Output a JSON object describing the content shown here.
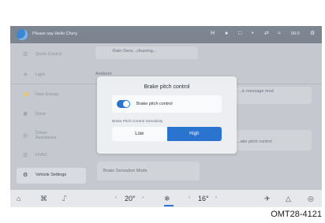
{
  "statusbar": {
    "prompt": "Please say Hello Chery",
    "icons": [
      "H",
      "●",
      "□",
      "•",
      "⇄",
      "≈"
    ],
    "time": "00:0",
    "settings_icon": "⚙"
  },
  "sidebar": {
    "items": [
      {
        "icon": "☰",
        "label": "Quick Control"
      },
      {
        "icon": "☀",
        "label": "Light"
      },
      {
        "icon": "⚡",
        "label": "New Energy"
      },
      {
        "icon": "☸",
        "label": "Drive"
      },
      {
        "icon": "◎",
        "label": "Driver Assistance"
      },
      {
        "icon": "☰",
        "label": "HVAC"
      },
      {
        "icon": "⚙",
        "label": "Vehicle Settings"
      }
    ]
  },
  "background": {
    "top_text": "Rain-Sens...cleaning...",
    "left_text": "Ambient",
    "right_text": "...ic message mod",
    "right_text2": "...ake pitch control",
    "bottom_text": "Brake Sensation Mode"
  },
  "dialog": {
    "title": "Brake pitch control",
    "toggle_label": "Brake pitch control",
    "toggle_on": true,
    "sensitivity_label": "Brake Pitch Control Sensitivity",
    "options": [
      "Low",
      "High"
    ],
    "selected": "High"
  },
  "bottombar": {
    "home_icon": "⌂",
    "apps_icon": "⌘",
    "seat_icon": "⑀",
    "left_temp": "20°",
    "fan_icon": "❄",
    "right_temp": "16°",
    "phone_icon": "✈",
    "nav_icon": "△",
    "settings_icon": "◎",
    "arrow_left": "‹",
    "arrow_right": "›"
  },
  "figure_id": "OMT28-4121"
}
